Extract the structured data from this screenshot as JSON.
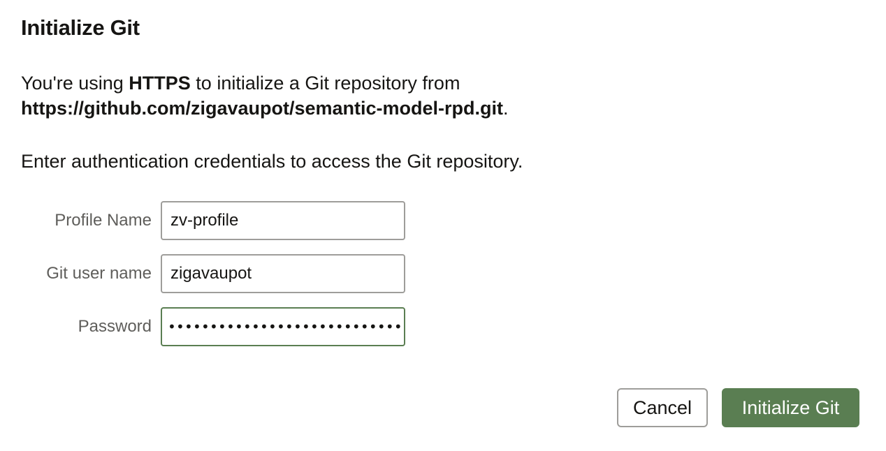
{
  "dialog": {
    "title": "Initialize Git",
    "intro": {
      "prefix": "You're using ",
      "protocol": "HTTPS",
      "middle": " to initialize a Git repository from",
      "repo_url": "https://github.com/zigavaupot/semantic-model-rpd.git",
      "suffix": "."
    },
    "instruction": "Enter authentication credentials to access the Git repository."
  },
  "form": {
    "profile_name": {
      "label": "Profile Name",
      "value": "zv-profile"
    },
    "git_user_name": {
      "label": "Git user name",
      "value": "zigavaupot"
    },
    "password": {
      "label": "Password",
      "masked_value": "•••••••••••••••••••••••••••••••••••••",
      "focused": true
    }
  },
  "buttons": {
    "cancel_label": "Cancel",
    "primary_label": "Initialize Git"
  },
  "colors": {
    "primary": "#5a7e52",
    "text": "#161513",
    "label": "#5f5e5b",
    "border": "#9e9d9a"
  }
}
